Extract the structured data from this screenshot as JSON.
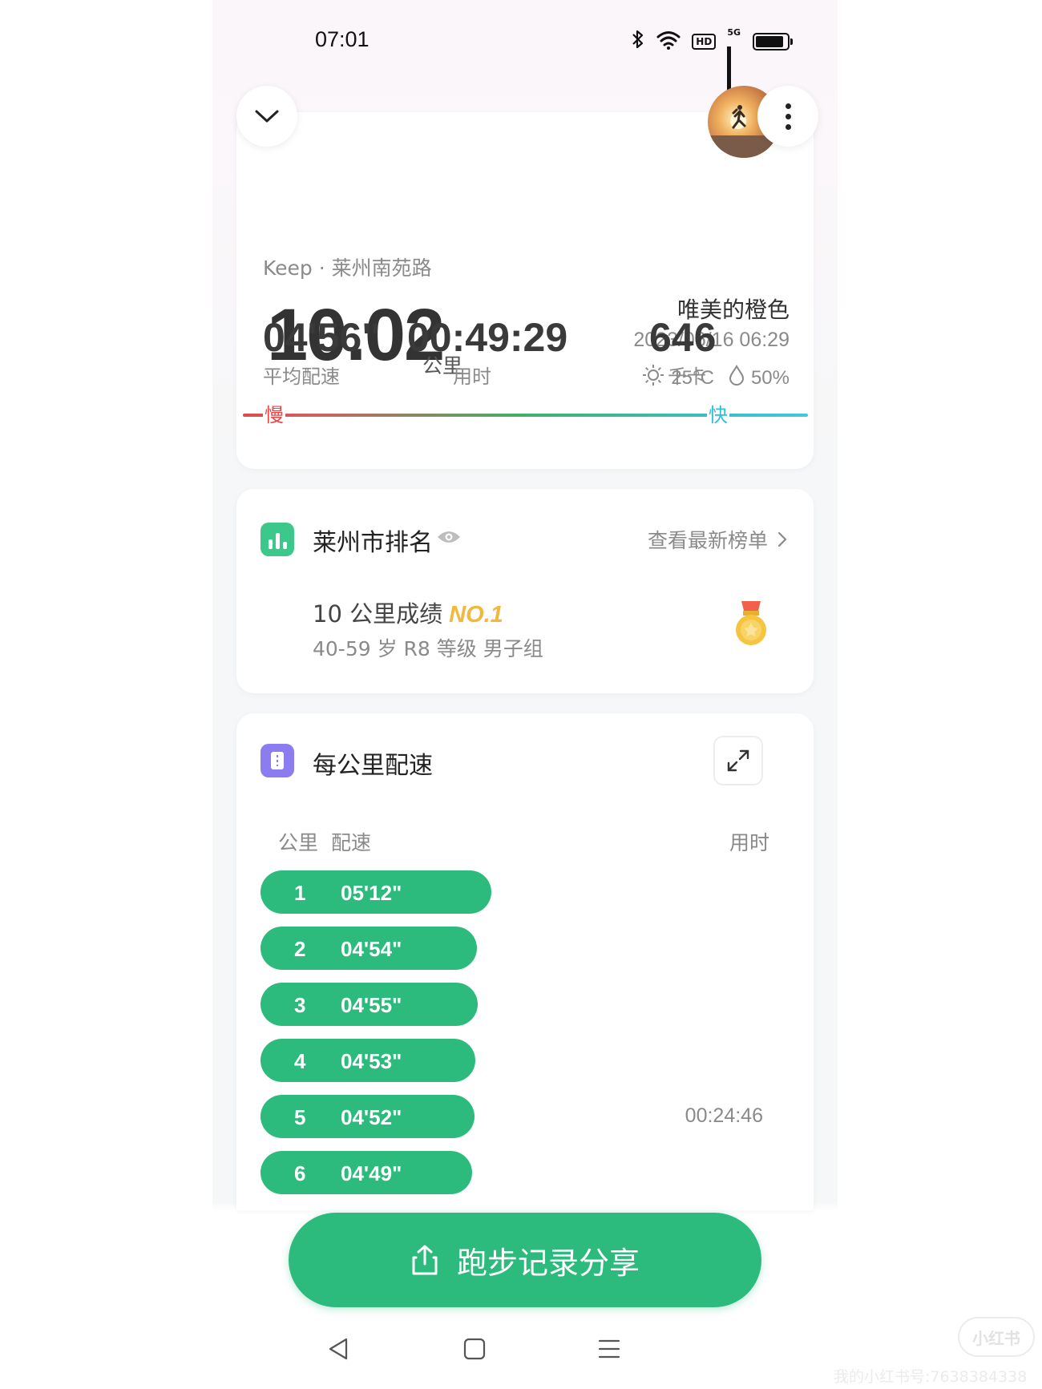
{
  "status_bar": {
    "time": "07:01",
    "icons": [
      "bluetooth-icon",
      "wifi-icon",
      "hd-icon",
      "5g-signal-icon",
      "battery-icon"
    ]
  },
  "header": {
    "collapse_icon": "chevron-down-icon",
    "more_icon": "more-vertical-icon",
    "avatar": "runner-sunrise-avatar"
  },
  "summary": {
    "source": "Keep · 莱州南苑路",
    "distance": "10.02",
    "distance_unit": "公里",
    "user_name": "唯美的橙色",
    "date": "2023/06/16 06:29",
    "temperature": "25°C",
    "humidity": "50%",
    "pace_slow_label": "慢",
    "pace_fast_label": "快",
    "stats": [
      {
        "value": "04'56\"",
        "label": "平均配速"
      },
      {
        "value": "00:49:29",
        "label": "用时"
      },
      {
        "value": "646",
        "label": "千卡"
      }
    ]
  },
  "ranking": {
    "title": "莱州市排名",
    "link": "查看最新榜单",
    "result_prefix": "10 公里成绩",
    "result_rank": "NO.1",
    "group": "40-59 岁 R8 等级 男子组",
    "medal_icon": "gold-medal-icon"
  },
  "splits": {
    "title": "每公里配速",
    "col_km": "公里",
    "col_pace": "配速",
    "col_time": "用时",
    "rows": [
      {
        "km": "1",
        "pace": "05'12\"",
        "pace_seconds": 312
      },
      {
        "km": "2",
        "pace": "04'54\"",
        "pace_seconds": 294
      },
      {
        "km": "3",
        "pace": "04'55\"",
        "pace_seconds": 295
      },
      {
        "km": "4",
        "pace": "04'53\"",
        "pace_seconds": 293
      },
      {
        "km": "5",
        "pace": "04'52\"",
        "pace_seconds": 292,
        "time": "00:24:46"
      },
      {
        "km": "6",
        "pace": "04'49\"",
        "pace_seconds": 289
      }
    ]
  },
  "share": {
    "label": "跑步记录分享",
    "icon": "share-upload-icon"
  },
  "navbar": {
    "icons": [
      "back-icon",
      "home-icon",
      "menu-icon"
    ]
  },
  "watermark": {
    "logo": "小红书",
    "text": "我的小红书号:7638384338"
  },
  "colors": {
    "accent": "#2dbb7d",
    "rank_gold": "#f2b83c",
    "pace_slow": "#e04a4a",
    "pace_fast": "#2ec0d8"
  }
}
